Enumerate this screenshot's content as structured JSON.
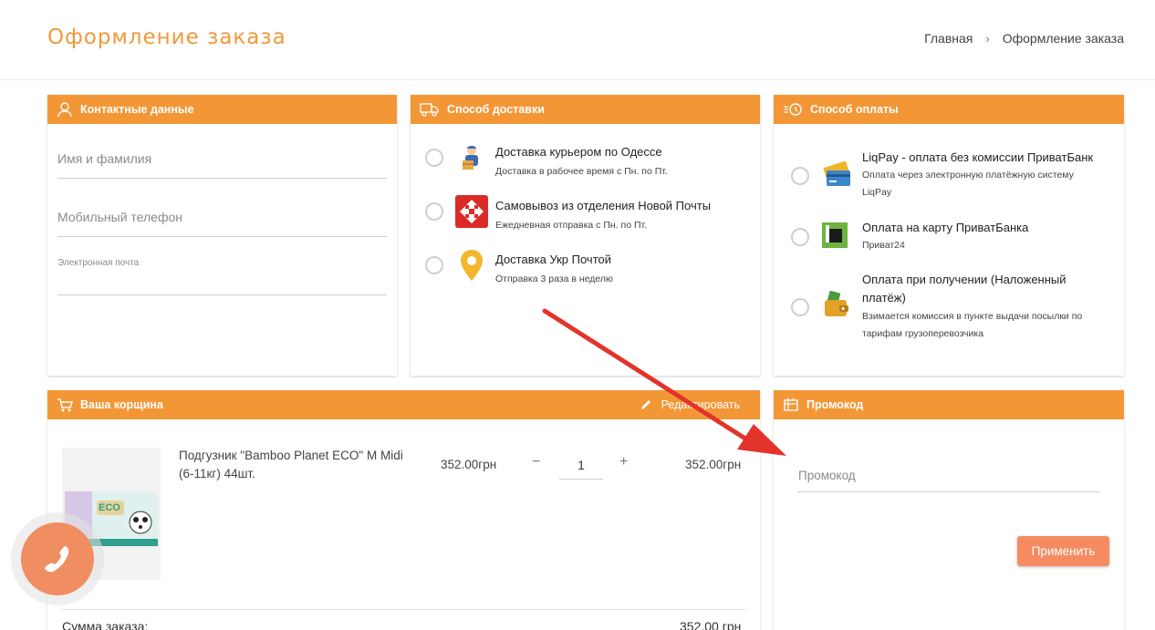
{
  "page_title": "Оформление заказа",
  "breadcrumb": {
    "home": "Главная",
    "separator": "›",
    "current": "Оформление заказа"
  },
  "contacts": {
    "title": "Контактные данные",
    "name_placeholder": "Имя и фамилия",
    "phone_placeholder": "Мобильный телефон",
    "email_label": "Электронная почта"
  },
  "delivery": {
    "title": "Способ доставки",
    "options": [
      {
        "title": "Доставка курьером по Одессе",
        "subtitle": "Доставка в рабочее время с Пн. по Пт.",
        "icon": "courier-icon"
      },
      {
        "title": "Самовывоз из отделения Новой Почты",
        "subtitle": "Ежедневная отправка с Пн. по Пт.",
        "icon": "nova-poshta-icon"
      },
      {
        "title": "Доставка Укр Почтой",
        "subtitle": "Отправка 3 раза в неделю",
        "icon": "map-pin-icon"
      }
    ]
  },
  "payment": {
    "title": "Способ оплаты",
    "options": [
      {
        "title": "LiqPay - оплата без комиссии ПриватБанк",
        "subtitle": "Оплата через электронную платёжную систему LiqPay",
        "icon": "cards-icon"
      },
      {
        "title": "Оплата на карту ПриватБанка",
        "subtitle": "Приват24",
        "icon": "privatbank-icon"
      },
      {
        "title": "Оплата при получении (Наложенный платёж)",
        "subtitle": "Взимается комиссия в пункте выдачи посылки по тарифам грузоперевозчика",
        "icon": "wallet-icon"
      }
    ]
  },
  "cart": {
    "title": "Ваша корщина",
    "edit_label": "Редактировать",
    "item": {
      "name": "Подгузник \"Bamboo Planet ECO\" M Midi (6-11кг) 44шт.",
      "price": "352.00грн",
      "quantity": "1",
      "minus": "−",
      "plus": "+",
      "total": "352.00грн",
      "image_label": "ECO"
    },
    "sum_label": "Сумма заказа:",
    "sum_value": "352.00 грн"
  },
  "promo": {
    "title": "Промокод",
    "placeholder": "Промокод",
    "apply_label": "Применить"
  },
  "colors": {
    "accent": "#f39736",
    "title": "#f0993a",
    "apply_button": "#f68b62",
    "call_button": "#f08d61",
    "arrow": "#e2342b"
  }
}
